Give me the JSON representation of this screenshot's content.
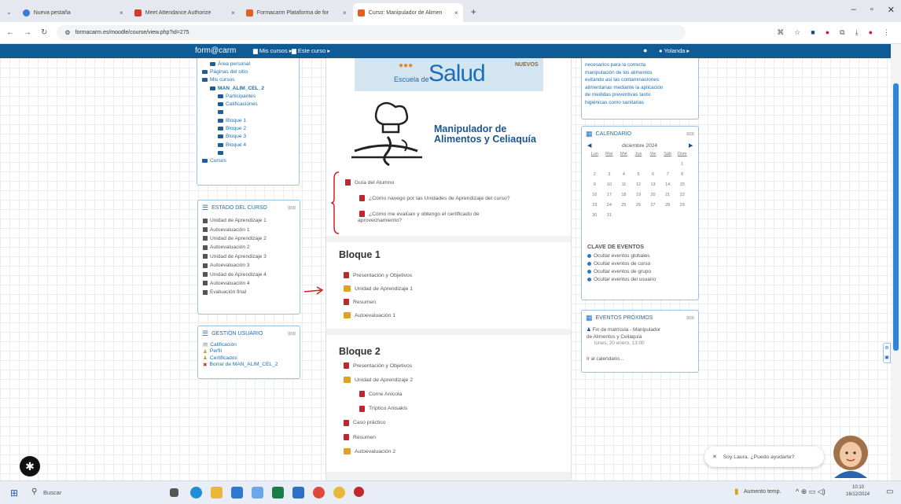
{
  "tabs": [
    {
      "label": "Nueva pestaña",
      "color": "#3a7ad8",
      "active": false
    },
    {
      "label": "Meet Attendance Authorize",
      "color": "#d33a2c",
      "active": false
    },
    {
      "label": "Formacarm Plataforma de for",
      "color": "#e06020",
      "active": false
    },
    {
      "label": "Curso: Manipulador de Alimen",
      "color": "#e06020",
      "active": true
    }
  ],
  "address": {
    "url": "formacarm.es/moodle/course/view.php?id=275"
  },
  "topbar": {
    "brand": "form@carm",
    "my_courses": "Mis cursos ▸",
    "this_course": "Este curso ▸",
    "user": "Yolanda ▸"
  },
  "nav": {
    "items": [
      {
        "label": "Área personal",
        "indent": 1
      },
      {
        "label": "Páginas del sitio",
        "indent": 0
      },
      {
        "label": "Mis cursos",
        "indent": 0
      },
      {
        "label": "MAN_ALIM_CEL_2",
        "indent": 1,
        "bold": true
      },
      {
        "label": "Participantes",
        "indent": 2
      },
      {
        "label": "Calificaciones",
        "indent": 2
      },
      {
        "label": "",
        "indent": 2
      },
      {
        "label": "Bloque 1",
        "indent": 2
      },
      {
        "label": "Bloque 2",
        "indent": 2
      },
      {
        "label": "Bloque 3",
        "indent": 2
      },
      {
        "label": "Bloque 4",
        "indent": 2
      },
      {
        "label": "",
        "indent": 2
      },
      {
        "label": "Cursos",
        "indent": 0
      }
    ]
  },
  "estado": {
    "title": "ESTADO DEL CURSO",
    "items": [
      "Unidad de Aprendizaje 1",
      "Autoevaluación 1",
      "Unidad de Aprendizaje 2",
      "Autoevaluación 2",
      "Unidad de Aprendizaje 3",
      "Autoevaluación 3",
      "Unidad de Aprendizaje 4",
      "Autoevaluación 4",
      "Evaluación final"
    ]
  },
  "gestion": {
    "title": "GESTIÓN USUARIO",
    "items": [
      "Calificación",
      "Perfil",
      "Certificados",
      "Borrar de MAN_ALIM_CEL_2"
    ]
  },
  "banner": {
    "escuela": "Escuela de",
    "salud": "Salud",
    "nuevos": "NUEVOS"
  },
  "course": {
    "title1": "Manipulador de",
    "title2": "Alimentos y Celiaquía"
  },
  "guide": {
    "title": "Guía del Alumno",
    "q1": "¿Cómo navego por las Unidades de Aprendizaje del curso?",
    "q2a": "¿Cómo me evalúan y obtengo el certificado de",
    "q2b": "aprovechamiento?"
  },
  "bloque1": {
    "title": "Bloque 1",
    "items": [
      "Presentación y Objetivos",
      "Unidad de Aprendizaje 1",
      "Resumen",
      "Autoevaluación 1"
    ]
  },
  "bloque2": {
    "title": "Bloque 2",
    "items": [
      "Presentación y Objetivos",
      "Unidad de Aprendizaje 2",
      "Corne Anicola",
      "Tríptico Anisakis",
      "Caso práctico",
      "Resumen",
      "Autoevaluación 2"
    ]
  },
  "desc": {
    "lines": [
      "necesarios para la correcta",
      "manipulación de los alimentos",
      "evitando así las contaminaciones",
      "alimentarias mediante la aplicación",
      "de medidas preventivas tanto",
      "higiénicas como sanitarias"
    ]
  },
  "calendar": {
    "title": "CALENDARIO",
    "month": "diciembre 2024",
    "days": [
      "Lun",
      "Mar",
      "Mié",
      "Jue",
      "Vie",
      "Sáb",
      "Dom"
    ],
    "cells": [
      "",
      "",
      "",
      "",
      "",
      "",
      "1",
      "2",
      "3",
      "4",
      "5",
      "6",
      "7",
      "8",
      "9",
      "10",
      "11",
      "12",
      "13",
      "14",
      "15",
      "16",
      "17",
      "18",
      "19",
      "20",
      "21",
      "22",
      "23",
      "24",
      "25",
      "26",
      "27",
      "28",
      "29",
      "30",
      "31",
      "",
      "",
      "",
      "",
      ""
    ]
  },
  "clave": {
    "title": "CLAVE DE EVENTOS",
    "items": [
      "Ocultar eventos globales",
      "Ocultar eventos de curso",
      "Ocultar eventos de grupo",
      "Ocultar eventos del usuario"
    ]
  },
  "proximos": {
    "title": "EVENTOS PRÓXIMOS",
    "e1": "Fin de matrícula - Manipulador",
    "e2": "de Alimentos y Celiaquía",
    "e3": "lunes, 20 enero, 13:00",
    "link": "Ir al calendario..."
  },
  "chat": {
    "text": "Soy Laura. ¿Puedo ayudarte?"
  },
  "taskbar": {
    "search": "Buscar",
    "weather": "Aumento temp.",
    "time": "10:10",
    "date": "16/12/2024"
  }
}
